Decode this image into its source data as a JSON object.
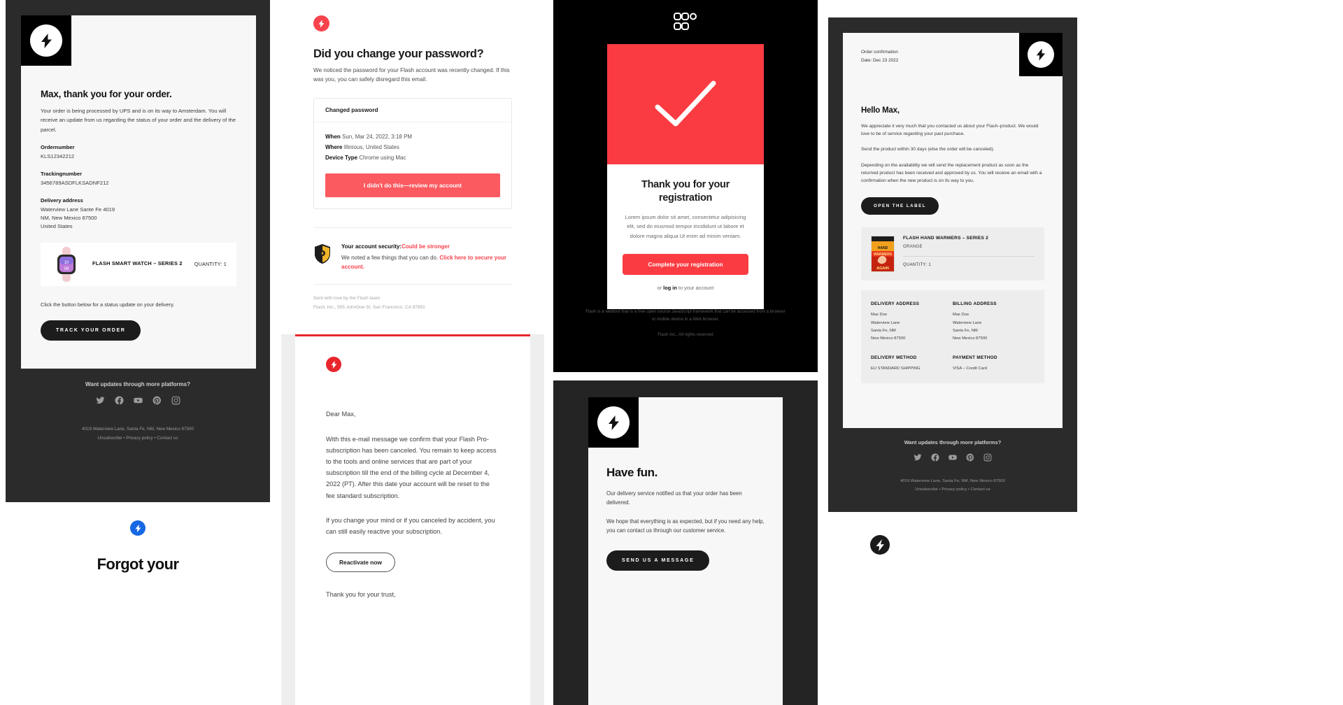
{
  "brand": {
    "name": "Flash",
    "accent_red": "#fb3b42",
    "accent_red_alt": "#e8262c",
    "dark": "#2b2b2b",
    "blue": "#1668e3"
  },
  "order_email": {
    "heading": "Max, thank you for your order.",
    "intro": "Your order is being processed by UPS and is on its way to Amsterdam. You will receive an update from us regarding the status of your order and the delivery of the parcel.",
    "ordernumber_label": "Ordernumber",
    "ordernumber_value": "KLS12342212",
    "trackingnumber_label": "Trackingnumber",
    "trackingnumber_value": "3456789ASDFLKSADNF212",
    "delivery_label": "Delivery address",
    "delivery_line1": "Waterview Lane Sante Fe 4019",
    "delivery_line2": "NM, New Mexico 87500",
    "delivery_line3": "United States",
    "product_name": "FLASH SMART WATCH – SERIES 2",
    "product_qty": "QUANTITY: 1",
    "note": "Click the button below for a status update on your delivery.",
    "cta": "TRACK YOUR ORDER",
    "footer_title": "Want updates through more platforms?",
    "footer_address": "4019 Waterview Lane, Santa Fe, NM, New Mexico 87500",
    "footer_links": "Unsubscribe • Privacy policy • Contact us",
    "socials": [
      "twitter-icon",
      "facebook-icon",
      "youtube-icon",
      "pinterest-icon",
      "instagram-icon"
    ]
  },
  "password_email": {
    "heading": "Did you change your password?",
    "sub": "We noticed the password for your Flash account was recently changed. If this was you, you can safely disregard this email.",
    "panel_title": "Changed password",
    "rows": [
      {
        "label": "When",
        "value": "Sun, Mar 24, 2022, 3:18 PM"
      },
      {
        "label": "Where",
        "value": "Illinious, United States"
      },
      {
        "label": "Device Type",
        "value": "Chrome using Mac"
      }
    ],
    "cta": "I didn't do this—review my account",
    "security_title": "Your account security:",
    "security_status": "Could be stronger",
    "security_text": "We noted a few things that you can do. ",
    "security_link": "Click here to secure your account.",
    "sent_line1": "Sent with love by the Flash team",
    "sent_line2": "Flash, Inc., 555 JohnDoe St. San Francisco, CA 97891"
  },
  "cancel_email": {
    "greeting": "Dear Max,",
    "paragraph1": "With this e-mail message we confirm that your Flash Pro-subscription has been canceled. You remain to keep access to the tools and online services that are part of your subscription till the end of the billing cycle at December 4, 2022 (PT). After this date your account will be reset to the fee standard subscription.",
    "paragraph2": "If you change your mind or if you canceled by accident, you can still easily reactive your subscription.",
    "cta": "Reactivate now",
    "closing": "Thank you for your trust,"
  },
  "registration_email": {
    "heading": "Thank you for your registration",
    "lorem": "Lorem ipsum dolor sit amet, consectetur adipisicing elit, sed do eiusmod tempor incididunt ut labore et dolore magna aliqua Ut enim ad minim veniam.",
    "cta": "Complete your registration",
    "login_prefix": "or ",
    "login_link": "log in",
    "login_suffix": " to your account",
    "disclaimer": "Flash is a webtool that is a free open source JavaScript framework that can be accessed from a browser or mobile device in a Web browser.",
    "copyright": "Flash Inc., All rights reserved"
  },
  "delivered_email": {
    "heading": "Have fun.",
    "paragraph1": "Our delivery service notified us that your order has been delivered.",
    "paragraph2": "We hope that everything is as expected, but if you need any help, you can contact us through our customer service.",
    "cta": "SEND US A MESSAGE"
  },
  "confirmation_email": {
    "meta_title": "Order confirmation",
    "meta_date": "Date: Dec 23 2022",
    "heading": "Hello Max,",
    "paragraph1": "We appreciate it very much that you contacted us about your Flash–product. We would love to be of service regarding your past purchase.",
    "paragraph2": "Send the product within 30 days (else the order will be canceled).",
    "paragraph3": "Depending on the availability we will send the replacement product as soon as the returned product has been received and approved by us. You will receive an email with a confirmation when the new product is on its way to you.",
    "cta": "OPEN THE LABEL",
    "product_name": "FLASH HAND WARMERS – SERIES 2",
    "product_variant": "ORANGE",
    "product_qty": "QUANTITY: 1",
    "blocks": [
      {
        "heading": "DELIVERY ADDRESS",
        "lines": [
          "Max Doe",
          "Waterview Lane",
          "Santa Fe, NM",
          "New Mexico 87500"
        ]
      },
      {
        "heading": "BILLING ADDRESS",
        "lines": [
          "Max Doe",
          "Waterview Lane",
          "Santa Fe, NM",
          "New Mexico 87500"
        ]
      },
      {
        "heading": "DELIVERY METHOD",
        "lines": [
          "EU STANDARD SHIPPING"
        ]
      },
      {
        "heading": "PAYMENT METHOD",
        "lines": [
          "VISA – Credit Card"
        ]
      }
    ],
    "footer_title": "Want updates through more platforms?",
    "footer_address": "4019 Waterview Lane, Santa Fe, NM, New Mexico 87500",
    "footer_links": "Unsubscribe • Privacy policy • Contact us"
  },
  "forgot_fragment": {
    "heading": "Forgot your"
  }
}
